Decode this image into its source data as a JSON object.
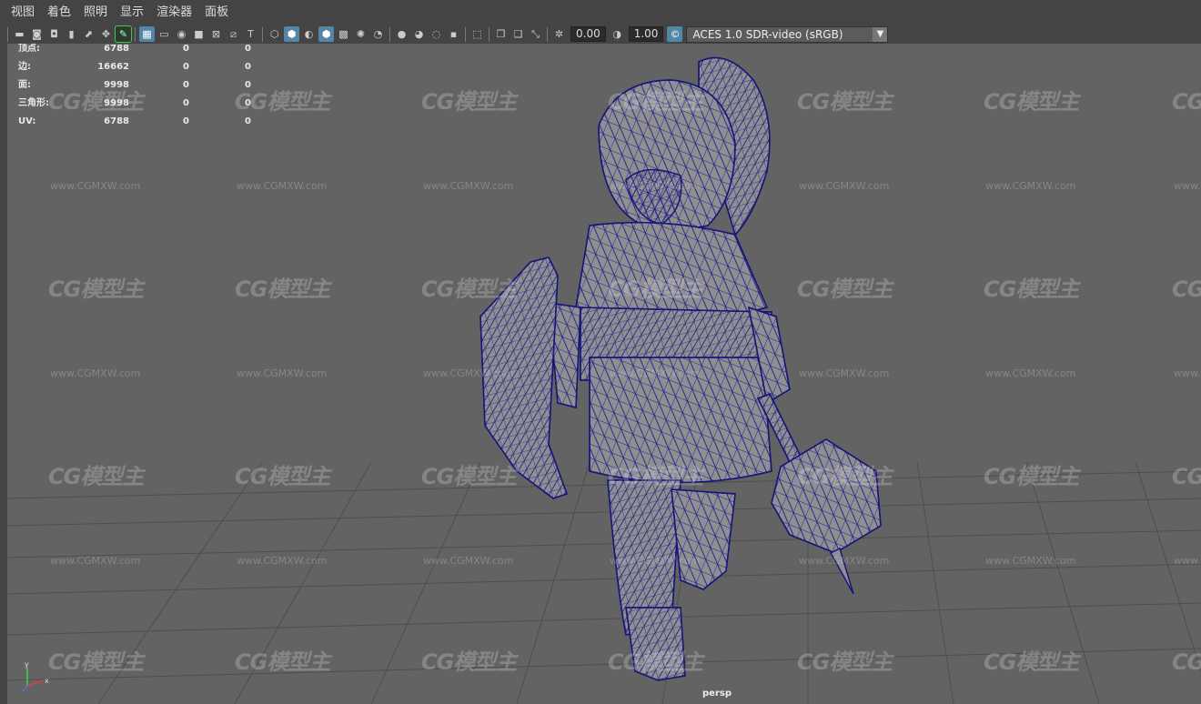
{
  "menu": [
    "视图",
    "着色",
    "照明",
    "显示",
    "渲染器",
    "面板"
  ],
  "toolbar": {
    "icons": [
      "camera-select-icon",
      "camera-attributes-icon",
      "bookmark-icon",
      "image-plane-icon",
      "2d-pan-icon",
      "grease-pencil-icon",
      "grid-icon",
      "film-gate-icon",
      "resolution-gate-icon",
      "gate-mask-icon",
      "field-chart-icon",
      "safe-action-icon",
      "safe-title-icon",
      "wireframe-icon",
      "smooth-shade-icon",
      "use-default-material-icon",
      "wireframe-on-shaded-icon",
      "xray-icon",
      "shadows-icon",
      "lights-icon",
      "ambient-occlusion-icon",
      "motion-blur-icon",
      "anti-aliasing-icon",
      "depth-of-field-icon",
      "isolate-select-icon",
      "camera-display-icon",
      "overscan-icon",
      "exposure-icon",
      "gamma-icon",
      "color-management-icon"
    ],
    "exposure_value": "0.00",
    "gamma_value": "1.00",
    "color_space": "ACES 1.0 SDR-video (sRGB)"
  },
  "hud": {
    "rows": [
      {
        "label": "顶点:",
        "values": [
          "6788",
          "0",
          "0"
        ]
      },
      {
        "label": "边:",
        "values": [
          "16662",
          "0",
          "0"
        ]
      },
      {
        "label": "面:",
        "values": [
          "9998",
          "0",
          "0"
        ]
      },
      {
        "label": "三角形:",
        "values": [
          "9998",
          "0",
          "0"
        ]
      },
      {
        "label": "UV:",
        "values": [
          "6788",
          "0",
          "0"
        ]
      }
    ]
  },
  "camera_name": "persp",
  "axis_labels": {
    "y": "y",
    "x": "x"
  },
  "watermark": {
    "logo": "CG模型主",
    "url": "www.CGMXW.com"
  },
  "colors": {
    "wire": "#17177a",
    "model_fill": "#8f8f92",
    "viewport_bg": "#636363",
    "grid_line": "#4d4d4d",
    "accent": "#5285a6"
  }
}
